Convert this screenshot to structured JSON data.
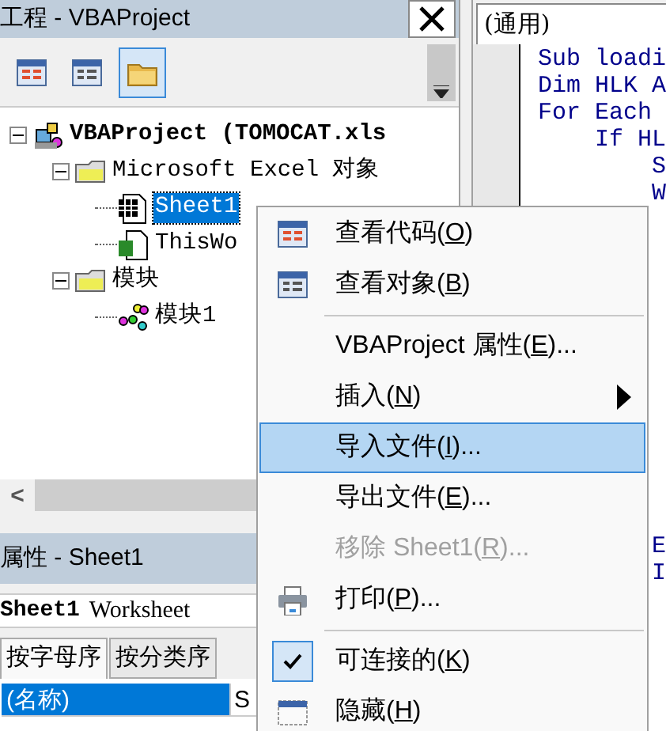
{
  "project_window": {
    "title": "工程 - VBAProject",
    "toolbar": [
      {
        "kind": "view-code",
        "selected": false
      },
      {
        "kind": "view-object",
        "selected": false
      },
      {
        "kind": "toggle-folders",
        "selected": true
      }
    ],
    "tree": [
      {
        "kind": "project",
        "label": "VBAProject (TOMOCAT.xls",
        "expanded": true,
        "selected": false,
        "children": [
          {
            "kind": "folder",
            "label": "Microsoft Excel 对象",
            "expanded": true,
            "selected": false,
            "children": [
              {
                "kind": "sheet",
                "label": "Sheet1",
                "selected": true
              },
              {
                "kind": "workbook",
                "label": "ThisWo",
                "selected": false
              }
            ]
          },
          {
            "kind": "folder",
            "label": "模块",
            "expanded": true,
            "selected": false,
            "children": [
              {
                "kind": "module",
                "label": "模块1",
                "selected": false
              }
            ]
          }
        ]
      }
    ],
    "scroll_left": "<"
  },
  "properties_window": {
    "title": "属性 - Sheet1",
    "object_name": "Sheet1",
    "object_type": "Worksheet",
    "tabs": [
      {
        "label": "按字母序",
        "selected": true
      },
      {
        "label": "按分类序",
        "selected": false
      }
    ],
    "rows": [
      {
        "name": "(名称)",
        "value": "S",
        "selected": true
      }
    ]
  },
  "code_window": {
    "object_combo": "(通用)",
    "lines_top": [
      "Sub loadi",
      "Dim HLK A",
      "For Each ",
      "    If HL",
      "        S",
      "        W"
    ],
    "lines_bottom": [
      "        E",
      "        I"
    ]
  },
  "context_menu": [
    {
      "kind": "view-code",
      "label": "查看代码(O)",
      "disabled": false,
      "selected": false
    },
    {
      "kind": "view-object",
      "label": "查看对象(B)",
      "disabled": false,
      "selected": false
    },
    {
      "kind": "separator"
    },
    {
      "kind": "item",
      "label": "VBAProject 属性(E)...",
      "disabled": false,
      "selected": false
    },
    {
      "kind": "submenu",
      "label": "插入(N)",
      "disabled": false,
      "selected": false
    },
    {
      "kind": "item",
      "label": "导入文件(I)...",
      "disabled": false,
      "selected": true
    },
    {
      "kind": "item",
      "label": "导出文件(E)...",
      "disabled": false,
      "selected": false
    },
    {
      "kind": "item",
      "label": "移除 Sheet1(R)...",
      "disabled": true,
      "selected": false
    },
    {
      "kind": "print",
      "label": "打印(P)...",
      "disabled": false,
      "selected": false
    },
    {
      "kind": "separator"
    },
    {
      "kind": "check",
      "label": "可连接的(K)",
      "checked": true,
      "disabled": false,
      "selected": false
    },
    {
      "kind": "hide",
      "label": "隐藏(H)",
      "disabled": false,
      "selected": false
    }
  ]
}
